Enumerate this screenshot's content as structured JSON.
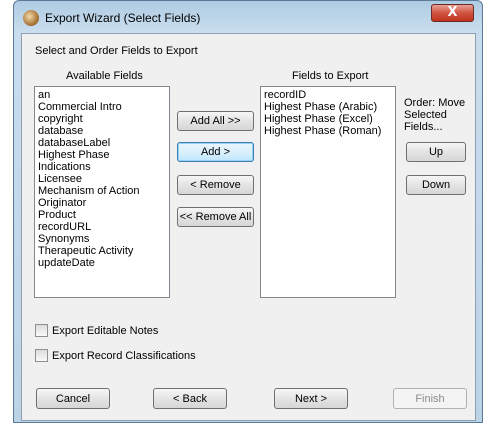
{
  "window": {
    "title": "Export Wizard (Select Fields)",
    "close_label": "X"
  },
  "instructions": "Select and Order Fields to Export",
  "available": {
    "heading": "Available Fields",
    "items": [
      "an",
      "Commercial Intro",
      "copyright",
      "database",
      "databaseLabel",
      "Highest Phase",
      "Indications",
      "Licensee",
      "Mechanism of Action",
      "Originator",
      "Product",
      "recordURL",
      "Synonyms",
      "Therapeutic Activity",
      "updateDate"
    ]
  },
  "export_fields": {
    "heading": "Fields to Export",
    "items": [
      "recordID",
      "Highest Phase (Arabic)",
      "Highest Phase (Excel)",
      "Highest Phase (Roman)"
    ]
  },
  "transfer_buttons": {
    "add_all": "Add All >>",
    "add": "Add >",
    "remove": "< Remove",
    "remove_all": "<< Remove All"
  },
  "order": {
    "label_line1": "Order: Move",
    "label_line2": "Selected",
    "label_line3": "Fields...",
    "up": "Up",
    "down": "Down"
  },
  "options": {
    "export_notes": "Export Editable Notes",
    "export_classifications": "Export Record Classifications"
  },
  "footer": {
    "cancel": "Cancel",
    "back": "< Back",
    "next": "Next >",
    "finish": "Finish"
  }
}
